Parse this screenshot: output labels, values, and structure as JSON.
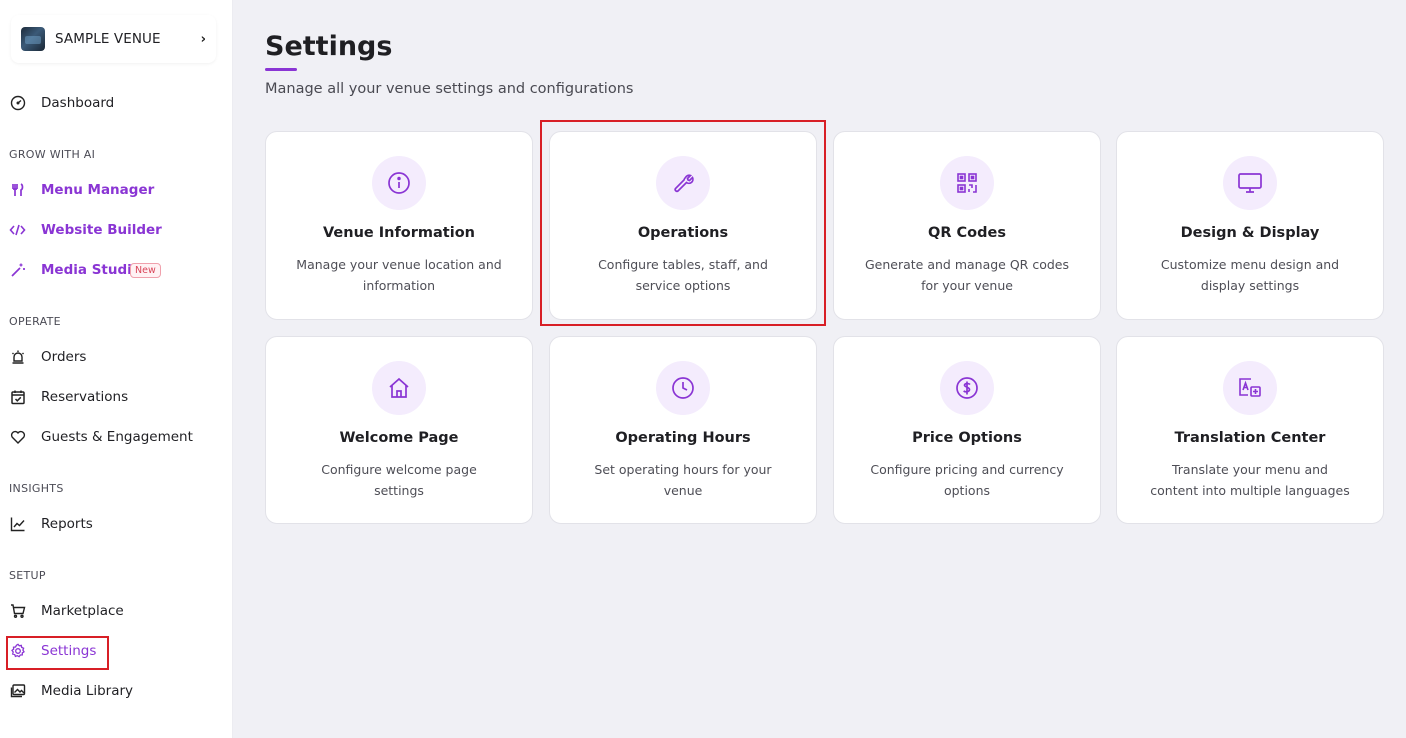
{
  "venue": {
    "name": "SAMPLE VENUE",
    "chevron": "›"
  },
  "sidebar": {
    "dashboard": "Dashboard",
    "section_ai": "GROW WITH AI",
    "menu_manager": "Menu Manager",
    "website_builder": "Website Builder",
    "media_studio": "Media Studio",
    "new_badge": "New",
    "section_operate": "OPERATE",
    "orders": "Orders",
    "reservations": "Reservations",
    "guests": "Guests & Engagement",
    "section_insights": "INSIGHTS",
    "reports": "Reports",
    "section_setup": "SETUP",
    "marketplace": "Marketplace",
    "settings": "Settings",
    "media_library": "Media Library"
  },
  "page": {
    "title": "Settings",
    "subtitle": "Manage all your venue settings and configurations"
  },
  "cards": [
    {
      "title": "Venue Information",
      "desc": "Manage your venue location and information",
      "icon": "info-icon"
    },
    {
      "title": "Operations",
      "desc": "Configure tables, staff, and service options",
      "icon": "wrench-icon"
    },
    {
      "title": "QR Codes",
      "desc": "Generate and manage QR codes for your venue",
      "icon": "qr-code-icon"
    },
    {
      "title": "Design & Display",
      "desc": "Customize menu design and display settings",
      "icon": "monitor-icon"
    },
    {
      "title": "Welcome Page",
      "desc": "Configure welcome page settings",
      "icon": "home-icon"
    },
    {
      "title": "Operating Hours",
      "desc": "Set operating hours for your venue",
      "icon": "clock-icon"
    },
    {
      "title": "Price Options",
      "desc": "Configure pricing and currency options",
      "icon": "dollar-icon"
    },
    {
      "title": "Translation Center",
      "desc": "Translate your menu and content into multiple languages",
      "icon": "translate-icon"
    }
  ],
  "colors": {
    "accent": "#8a35d4",
    "highlight": "#d81f26",
    "background": "#f0f0f5"
  }
}
